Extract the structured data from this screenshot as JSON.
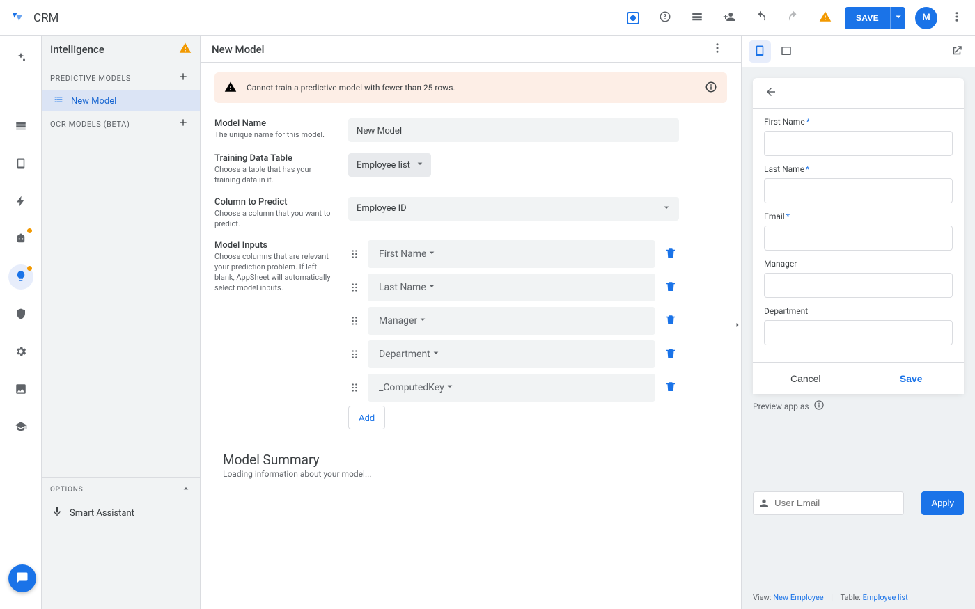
{
  "header": {
    "app_name": "CRM",
    "save_label": "SAVE",
    "avatar_initial": "M"
  },
  "sidebar": {
    "title": "Intelligence",
    "groups": {
      "predictive": "PREDICTIVE MODELS",
      "ocr": "OCR MODELS (BETA)"
    },
    "items": {
      "new_model": "New Model"
    },
    "options_label": "OPTIONS",
    "smart_assistant": "Smart Assistant"
  },
  "main": {
    "title": "New Model",
    "alert": "Cannot train a predictive model with fewer than 25 rows.",
    "fields": {
      "name": {
        "label": "Model Name",
        "hint": "The unique name for this model.",
        "value": "New Model"
      },
      "table": {
        "label": "Training Data Table",
        "hint": "Choose a table that has your training data in it.",
        "value": "Employee list"
      },
      "predict": {
        "label": "Column to Predict",
        "hint": "Choose a column that you want to predict.",
        "value": "Employee ID"
      },
      "inputs": {
        "label": "Model Inputs",
        "hint": "Choose columns that are relevant your prediction problem. If left blank, AppSheet will automatically select model inputs.",
        "values": [
          "First Name",
          "Last Name",
          "Manager",
          "Department",
          "_ComputedKey"
        ],
        "add_label": "Add"
      }
    },
    "summary": {
      "title": "Model Summary",
      "body": "Loading information about your model..."
    }
  },
  "preview": {
    "form_fields": [
      {
        "label": "First Name",
        "required": true
      },
      {
        "label": "Last Name",
        "required": true
      },
      {
        "label": "Email",
        "required": true
      },
      {
        "label": "Manager",
        "required": false
      },
      {
        "label": "Department",
        "required": false
      }
    ],
    "cancel": "Cancel",
    "save": "Save",
    "preview_as": "Preview app as",
    "email_placeholder": "User Email",
    "apply": "Apply",
    "meta": {
      "view_label": "View:",
      "view_value": "New Employee",
      "table_label": "Table:",
      "table_value": "Employee list"
    }
  }
}
